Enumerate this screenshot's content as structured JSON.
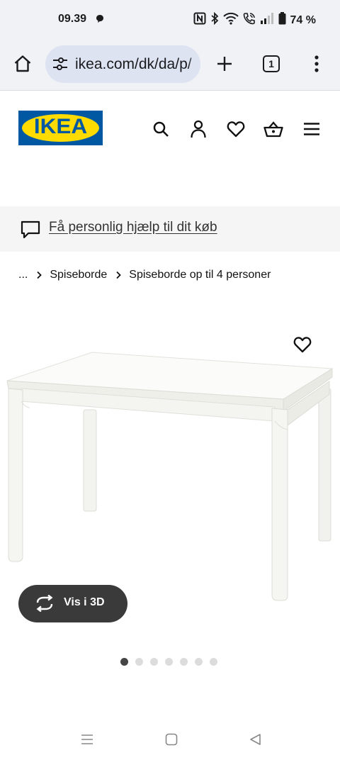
{
  "status_bar": {
    "time": "09.39",
    "battery": "74 %"
  },
  "browser": {
    "url": "ikea.com/dk/da/p/",
    "tab_count": "1"
  },
  "header": {
    "logo_text": "IKEA",
    "brand_colors": {
      "blue": "#0058a3",
      "yellow": "#ffdb00"
    },
    "icons": [
      "search-icon",
      "account-icon",
      "favourites-icon",
      "basket-icon",
      "menu-icon"
    ]
  },
  "help_banner": {
    "text": "Få personlig hjælp til dit køb"
  },
  "breadcrumb": {
    "ellipsis": "...",
    "items": [
      "Spiseborde",
      "Spiseborde op til 4 personer"
    ]
  },
  "product": {
    "image_alt": "white dining table",
    "vis3d_label": "Vis i 3D",
    "image_count": 7,
    "active_image_index": 0
  },
  "nav_bar": {
    "icons": [
      "recents-icon",
      "home-icon",
      "back-icon"
    ]
  }
}
